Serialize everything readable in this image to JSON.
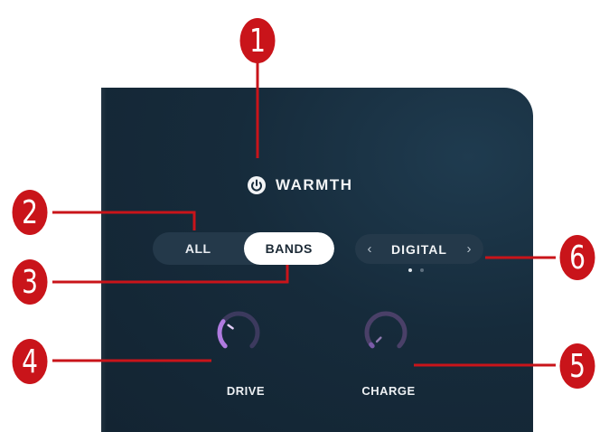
{
  "header": {
    "title": "WARMTH",
    "power_icon": "power-icon"
  },
  "tabs": [
    {
      "label": "ALL",
      "active": false
    },
    {
      "label": "BANDS",
      "active": true
    }
  ],
  "mode_selector": {
    "value": "DIGITAL",
    "prev_icon": "chevron-left-icon",
    "next_icon": "chevron-right-icon",
    "page_indicator": {
      "pages": 2,
      "current": 1
    }
  },
  "knobs": [
    {
      "label": "DRIVE",
      "value_fraction": 0.3,
      "color": "#b07be0"
    },
    {
      "label": "CHARGE",
      "value_fraction": 0.0,
      "color": "#7a5aa8"
    }
  ],
  "callouts": [
    "1",
    "2",
    "3",
    "4",
    "5",
    "6"
  ],
  "colors": {
    "panel": "#162b3b",
    "callout": "#c9141a",
    "accent": "#b07be0"
  }
}
